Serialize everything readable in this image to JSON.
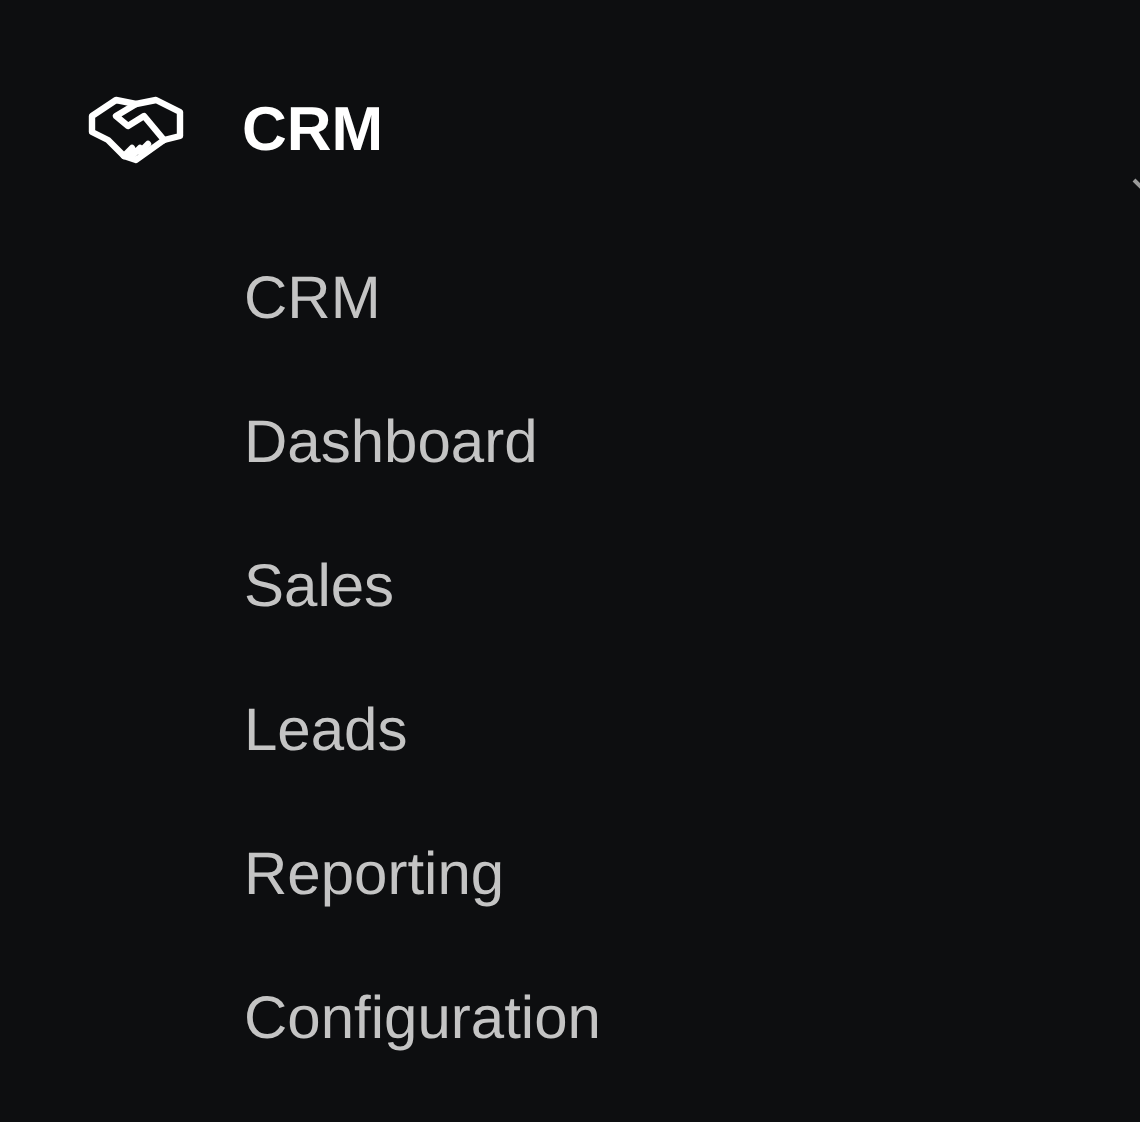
{
  "menu": {
    "title": "CRM",
    "expanded": true,
    "items": [
      {
        "label": "CRM"
      },
      {
        "label": "Dashboard"
      },
      {
        "label": "Sales"
      },
      {
        "label": "Leads"
      },
      {
        "label": "Reporting"
      },
      {
        "label": "Configuration"
      }
    ]
  }
}
